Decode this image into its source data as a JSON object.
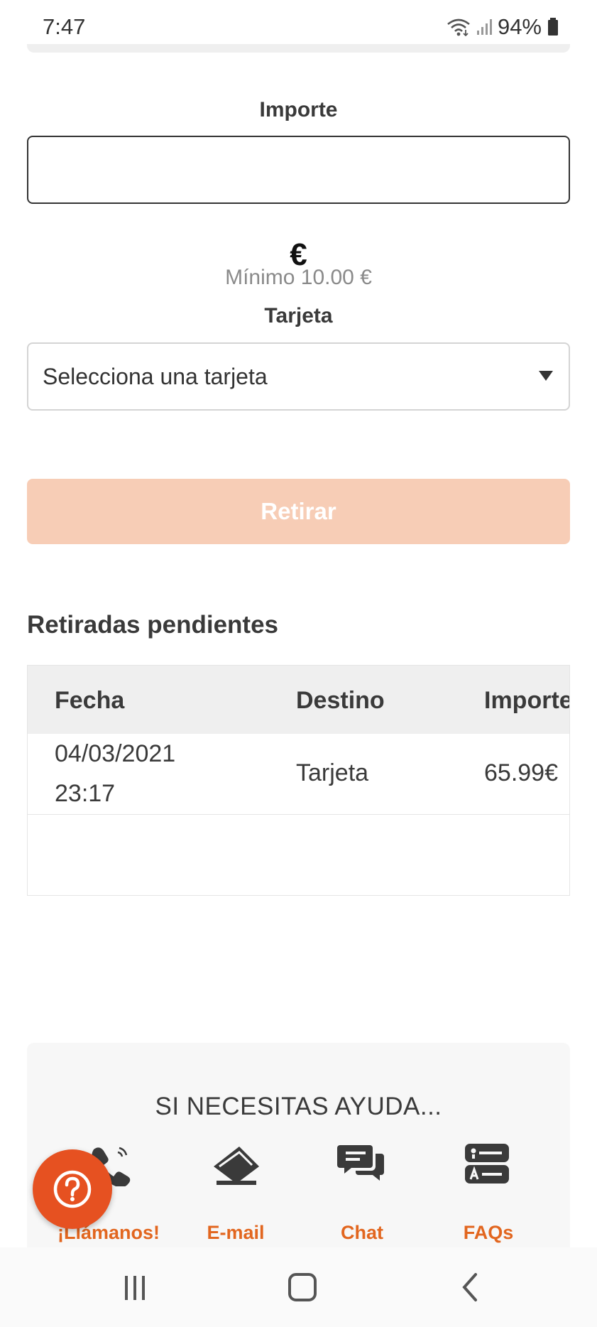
{
  "status_bar": {
    "time": "7:47",
    "battery": "94%"
  },
  "form": {
    "amount_label": "Importe",
    "amount_value": "",
    "currency_symbol": "€",
    "minimum_text": "Mínimo 10.00 €",
    "card_label": "Tarjeta",
    "card_select_value": "Selecciona una tarjeta",
    "withdraw_button": "Retirar"
  },
  "pending": {
    "title": "Retiradas pendientes",
    "columns": [
      "Fecha",
      "Destino",
      "Importe"
    ],
    "rows": [
      {
        "date": "04/03/2021",
        "time": "23:17",
        "destination": "Tarjeta",
        "amount": "65.99€"
      }
    ]
  },
  "help": {
    "title": "SI NECESITAS AYUDA...",
    "items": [
      {
        "label": "¡Llámanos!",
        "icon": "phone-icon"
      },
      {
        "label": "E-mail",
        "icon": "email-icon"
      },
      {
        "label": "Chat",
        "icon": "chat-icon"
      },
      {
        "label": "FAQs",
        "icon": "faq-icon"
      }
    ]
  },
  "colors": {
    "accent": "#e2661f",
    "fab": "#e65121",
    "button_disabled": "#f7cdb6"
  }
}
